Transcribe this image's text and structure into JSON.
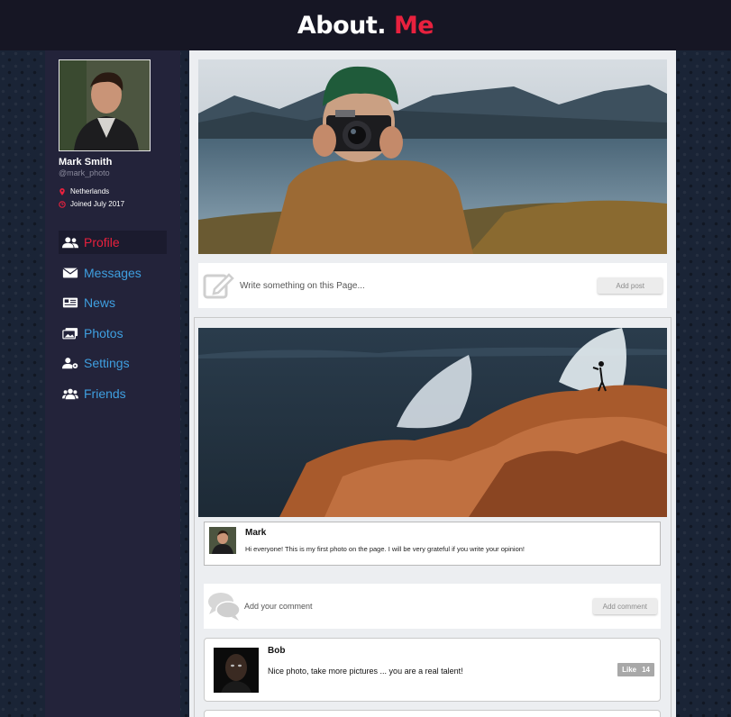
{
  "header": {
    "logo_main": "About.",
    "logo_accent": "Me"
  },
  "profile": {
    "name": "Mark Smith",
    "handle": "@mark_photo",
    "location": "Netherlands",
    "joined": "Joined July 2017"
  },
  "nav": {
    "items": [
      {
        "label": "Profile",
        "icon": "users-icon",
        "active": true
      },
      {
        "label": "Messages",
        "icon": "envelope-icon"
      },
      {
        "label": "News",
        "icon": "newspaper-icon"
      },
      {
        "label": "Photos",
        "icon": "images-icon"
      },
      {
        "label": "Settings",
        "icon": "user-gear-icon"
      },
      {
        "label": "Friends",
        "icon": "users-icon"
      }
    ]
  },
  "composer": {
    "placeholder": "Write something on this Page...",
    "button": "Add post"
  },
  "post": {
    "author": "Mark",
    "text": "Hi everyone! This is my first photo on the page. I will be very grateful if you write your opinion!"
  },
  "comment_form": {
    "placeholder": "Add your comment",
    "button": "Add comment"
  },
  "comments": [
    {
      "author": "Bob",
      "text": "Nice photo, take more pictures ... you are a real talent!",
      "like_label": "Like",
      "like_count": "14"
    }
  ],
  "colors": {
    "accent": "#e8213e",
    "link": "#3f9fe0",
    "sidebar": "#23233a",
    "header": "#161624"
  }
}
